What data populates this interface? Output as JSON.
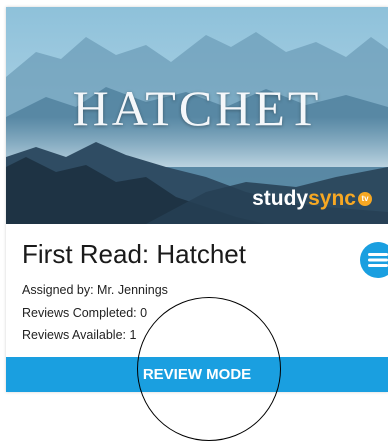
{
  "card": {
    "image_title": "HATCHET",
    "brand_study": "study",
    "brand_sync": "sync",
    "brand_tv": "tv",
    "title": "First Read: Hatchet",
    "assigned_by": "Assigned by: Mr. Jennings",
    "reviews_completed": "Reviews Completed: 0",
    "reviews_available": "Reviews Available: 1",
    "action_label": "REVIEW MODE",
    "menu_icon": "hamburger-menu-icon"
  },
  "colors": {
    "accent": "#1a9fe0",
    "brand_orange": "#f7a823"
  }
}
